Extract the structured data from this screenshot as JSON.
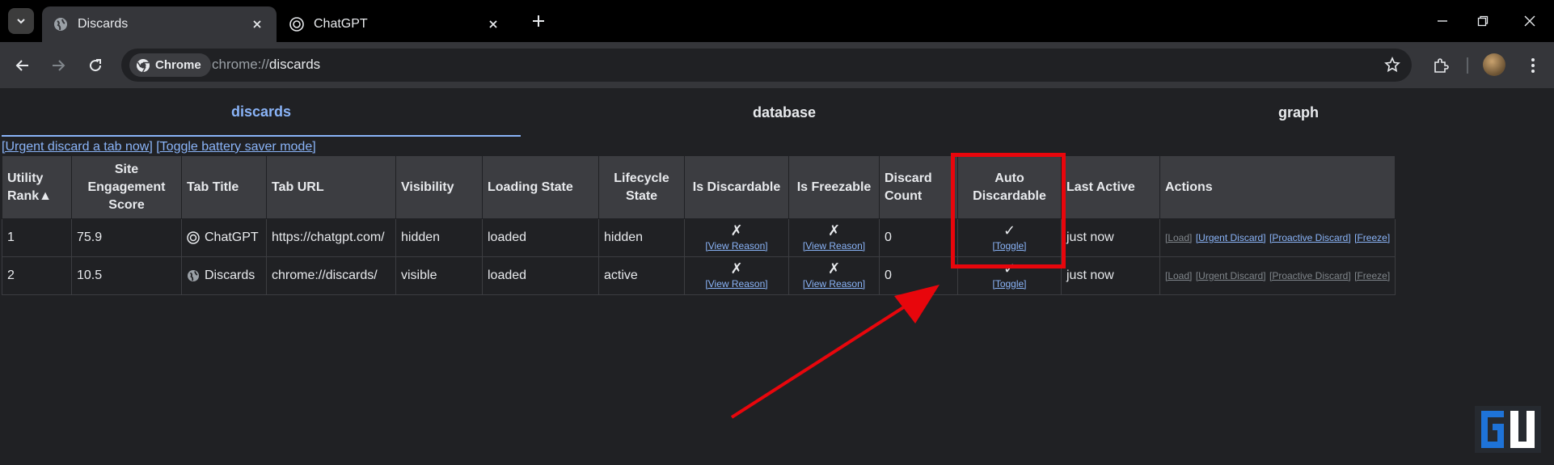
{
  "browser": {
    "tabs": [
      {
        "title": "Discards",
        "active": true
      },
      {
        "title": "ChatGPT",
        "active": false
      }
    ],
    "omnibox": {
      "chip_label": "Chrome",
      "url_scheme": "chrome://",
      "url_host": "discards"
    }
  },
  "page": {
    "nav_tabs": [
      "discards",
      "database",
      "graph"
    ],
    "action_links": [
      "[Urgent discard a tab now]",
      "[Toggle battery saver mode]"
    ],
    "table": {
      "headers": {
        "utility_rank": "Utility Rank",
        "sort_indicator": "▲",
        "site_engagement": "Site Engagement Score",
        "tab_title": "Tab Title",
        "tab_url": "Tab URL",
        "visibility": "Visibility",
        "loading_state": "Loading State",
        "lifecycle_state": "Lifecycle State",
        "is_discardable": "Is Discardable",
        "is_freezable": "Is Freezable",
        "discard_count": "Discard Count",
        "auto_discardable": "Auto Discardable",
        "last_active": "Last Active",
        "actions": "Actions"
      },
      "rows": [
        {
          "rank": "1",
          "score": "75.9",
          "title": "ChatGPT",
          "url": "https://chatgpt.com/",
          "visibility": "hidden",
          "loading": "loaded",
          "lifecycle": "hidden",
          "discardable": "✗",
          "discardable_link": "[View Reason]",
          "freezable": "✗",
          "freezable_link": "[View Reason]",
          "discard_count": "0",
          "auto": "✓",
          "auto_link": "[Toggle]",
          "last_active": "just now",
          "actions": [
            "[Load]",
            "[Urgent Discard]",
            "[Proactive Discard]",
            "[Freeze]"
          ]
        },
        {
          "rank": "2",
          "score": "10.5",
          "title": "Discards",
          "url": "chrome://discards/",
          "visibility": "visible",
          "loading": "loaded",
          "lifecycle": "active",
          "discardable": "✗",
          "discardable_link": "[View Reason]",
          "freezable": "✗",
          "freezable_link": "[View Reason]",
          "discard_count": "0",
          "auto": "✓",
          "auto_link": "[Toggle]",
          "last_active": "just now",
          "actions": [
            "[Load]",
            "[Urgent Discard]",
            "[Proactive Discard]",
            "[Freeze]"
          ]
        }
      ]
    }
  },
  "annotation": {
    "color": "#e8060c"
  }
}
